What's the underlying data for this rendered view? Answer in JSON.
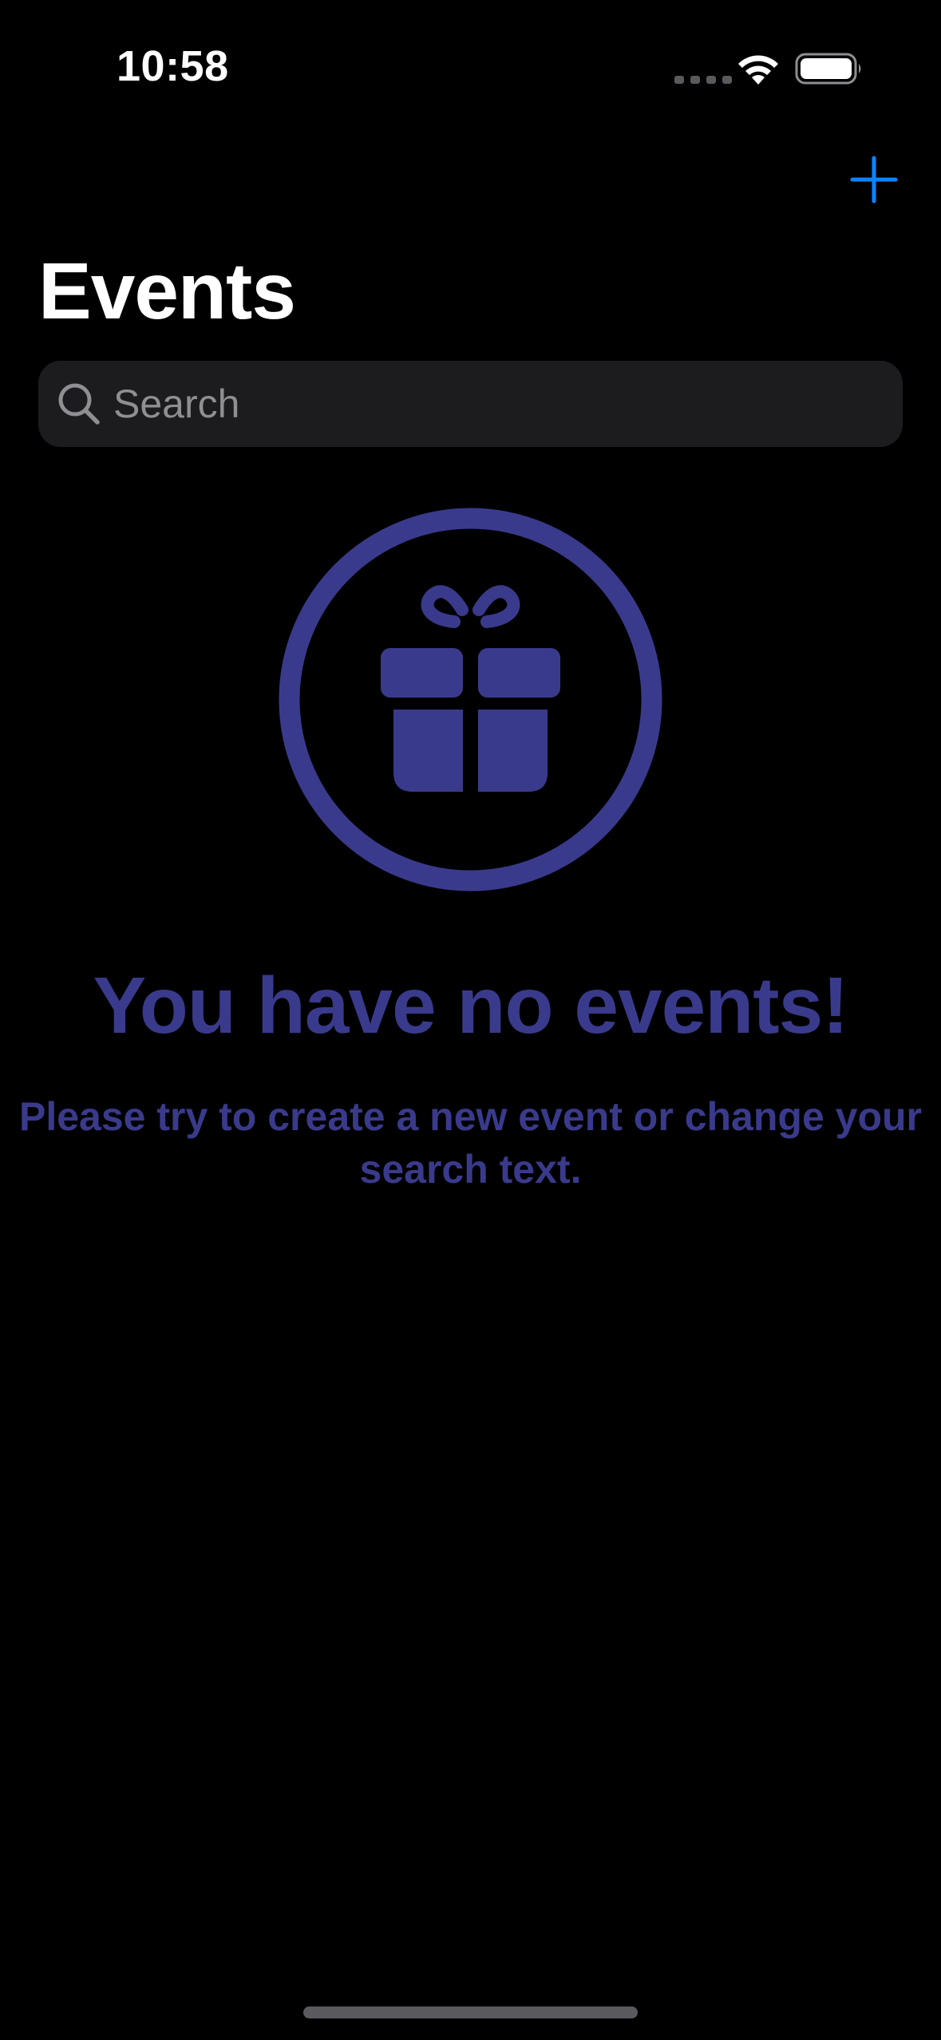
{
  "status_bar": {
    "time": "10:58",
    "icons": [
      "cellular-signal-icon",
      "wifi-icon",
      "battery-icon"
    ]
  },
  "nav": {
    "title": "Events",
    "add_icon": "plus-icon"
  },
  "search": {
    "placeholder": "Search",
    "value": "",
    "icon": "magnifying-glass-icon"
  },
  "empty_state": {
    "icon": "gift-icon",
    "title": "You have no events!",
    "message": "Please try to create a new event or change your search text."
  },
  "colors": {
    "background": "#000000",
    "accent": "#0a84ff",
    "empty_state": "#3a3a8c",
    "search_field": "#1c1c1e",
    "placeholder": "#8e8e93"
  }
}
